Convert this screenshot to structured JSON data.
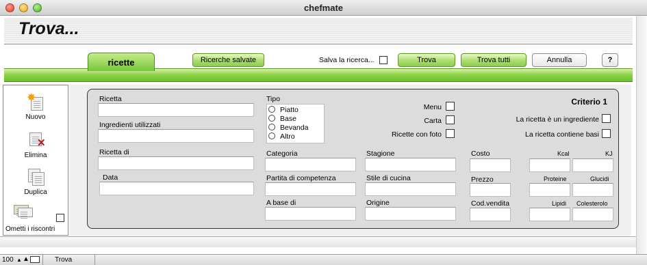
{
  "window": {
    "title": "chefmate"
  },
  "header": {
    "title": "Trova..."
  },
  "tabs": {
    "active": "ricette"
  },
  "toolbar": {
    "saved_searches": "Ricerche salvate",
    "save_search_label": "Salva la ricerca...",
    "find": "Trova",
    "find_all": "Trova tutti",
    "cancel": "Annulla",
    "help": "?"
  },
  "tools": {
    "new": "Nuovo",
    "delete": "Elimina",
    "duplicate": "Duplica",
    "omit_matches": "Ometti i riscontri"
  },
  "form": {
    "criterion_title": "Criterio 1",
    "ricetta": "Ricetta",
    "ingredienti": "Ingredienti utilizzati",
    "ricetta_di": "Ricetta di",
    "data": "Data",
    "tipo": "Tipo",
    "tipo_options": [
      "Piatto",
      "Base",
      "Bevanda",
      "Altro"
    ],
    "menu": "Menu",
    "carta": "Carta",
    "ricette_con_foto": "Ricette con foto",
    "is_ingredient": "La ricetta è un ingrediente",
    "contains_bases": "La ricetta contiene basi",
    "categoria": "Categoria",
    "stagione": "Stagione",
    "costo": "Costo",
    "partita": "Partita di competenza",
    "stile": "Stile di cucina",
    "prezzo": "Prezzo",
    "a_base_di": "A base di",
    "origine": "Origine",
    "cod_vendita": "Cod.vendita",
    "kcal": "Kcal",
    "kj": "KJ",
    "proteine": "Proteine",
    "glucidi": "Glucidi",
    "lipidi": "Lipidi",
    "colesterolo": "Colesterolo"
  },
  "status": {
    "zoom": "100",
    "mode": "Trova"
  }
}
